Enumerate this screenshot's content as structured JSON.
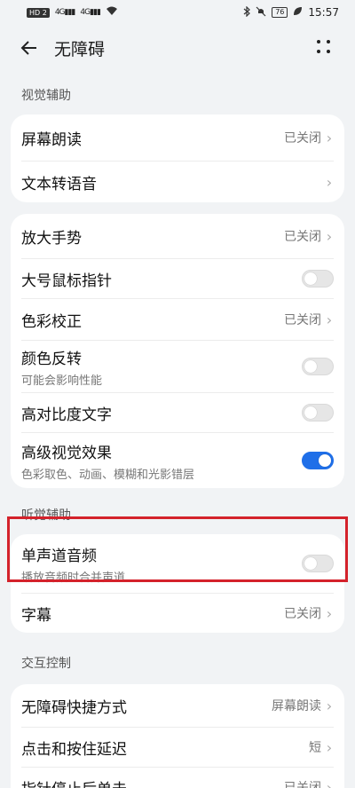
{
  "status": {
    "hd_badge": "HD 2",
    "signal1": "4G",
    "signal2": "4G",
    "battery": "76",
    "time": "15:57"
  },
  "header": {
    "title": "无障碍"
  },
  "sections": {
    "visual": "视觉辅助",
    "hearing": "听觉辅助",
    "interaction": "交互控制"
  },
  "card1": [
    {
      "title": "屏幕朗读",
      "value": "已关闭"
    },
    {
      "title": "文本转语音",
      "value": ""
    }
  ],
  "card2": [
    {
      "title": "放大手势",
      "value": "已关闭"
    },
    {
      "title": "大号鼠标指针",
      "toggle": "off"
    },
    {
      "title": "色彩校正",
      "value": "已关闭"
    },
    {
      "title": "颜色反转",
      "subtitle": "可能会影响性能",
      "toggle": "off"
    },
    {
      "title": "高对比度文字",
      "toggle": "off"
    },
    {
      "title": "高级视觉效果",
      "subtitle": "色彩取色、动画、模糊和光影错层",
      "toggle": "on"
    }
  ],
  "card3": [
    {
      "title": "单声道音频",
      "subtitle": "播放音频时合并声道",
      "toggle": "off"
    },
    {
      "title": "字幕",
      "value": "已关闭"
    }
  ],
  "card4": [
    {
      "title": "无障碍快捷方式",
      "value": "屏幕朗读"
    },
    {
      "title": "点击和按住延迟",
      "value": "短"
    },
    {
      "title": "指针停止后单击",
      "value": "已关闭"
    }
  ],
  "colors": {
    "accent": "#1f6fe8",
    "highlight": "#d4222b"
  }
}
